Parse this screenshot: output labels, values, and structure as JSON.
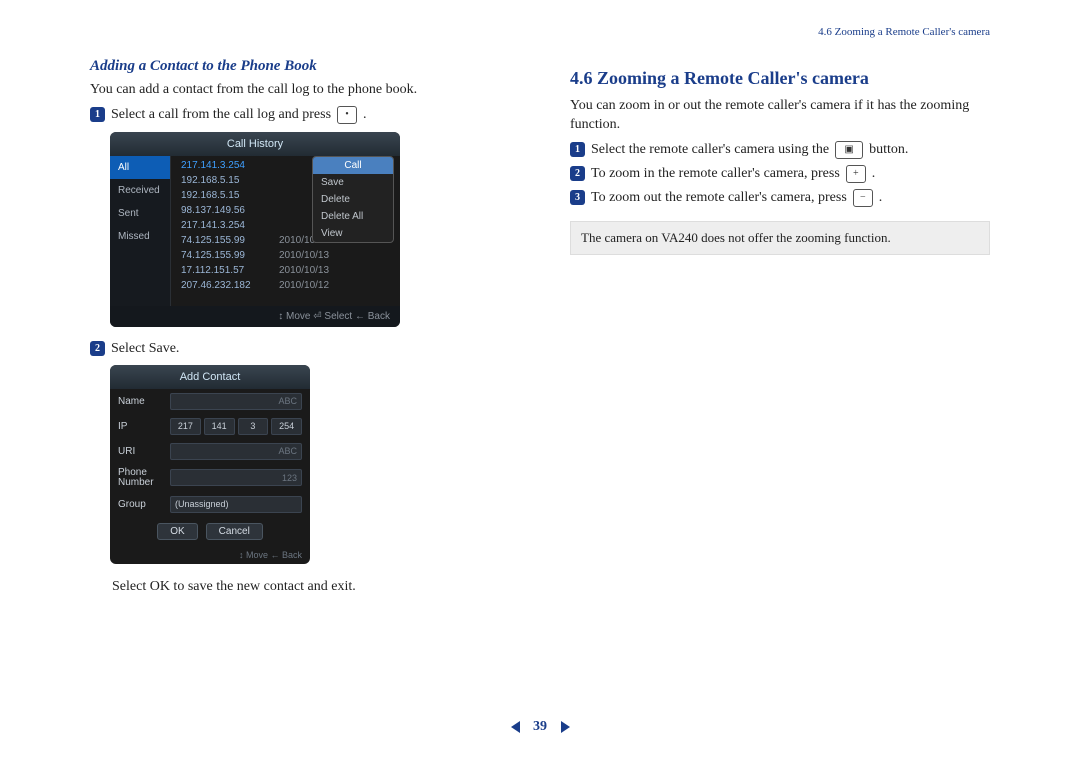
{
  "header": {
    "breadcrumb": "4.6 Zooming a Remote Caller's camera"
  },
  "left": {
    "heading": "Adding a Contact to the Phone Book",
    "intro": "You can add a contact from the call log to the phone book.",
    "step1": "Select a call from the call log and press",
    "step2": "Select Save.",
    "finish": "Select OK to save the new contact and exit.",
    "call_history": {
      "title": "Call History",
      "tabs": [
        "All",
        "Received",
        "Sent",
        "Missed"
      ],
      "rows": [
        {
          "ip": "217.141.3.254",
          "date": ""
        },
        {
          "ip": "192.168.5.15",
          "date": ""
        },
        {
          "ip": "192.168.5.15",
          "date": ""
        },
        {
          "ip": "98.137.149.56",
          "date": ""
        },
        {
          "ip": "217.141.3.254",
          "date": ""
        },
        {
          "ip": "74.125.155.99",
          "date": "2010/10/14"
        },
        {
          "ip": "74.125.155.99",
          "date": "2010/10/13"
        },
        {
          "ip": "17.112.151.57",
          "date": "2010/10/13"
        },
        {
          "ip": "207.46.232.182",
          "date": "2010/10/12"
        }
      ],
      "menu": {
        "header": "Call",
        "items": [
          "Save",
          "Delete",
          "Delete All",
          "View"
        ]
      },
      "footer": "↕ Move   ⏎ Select   ← Back"
    },
    "add_contact": {
      "title": "Add Contact",
      "name_label": "Name",
      "name_hint": "ABC",
      "ip_label": "IP",
      "ip": [
        "217",
        "141",
        "3",
        "254"
      ],
      "uri_label": "URI",
      "uri_hint": "ABC",
      "phone_label": "Phone Number",
      "phone_hint": "123",
      "group_label": "Group",
      "group_value": "(Unassigned)",
      "ok": "OK",
      "cancel": "Cancel",
      "footer": "↕ Move   ← Back"
    }
  },
  "right": {
    "heading": "4.6   Zooming a Remote Caller's camera",
    "intro": "You can zoom in or out the remote caller's camera if it has the zooming function.",
    "step1a": "Select the remote caller's camera using the",
    "step1b": "button.",
    "step2": "To zoom in the remote caller's camera, press",
    "step3": "To zoom out the remote caller's camera, press",
    "note": "The camera on VA240 does not offer the zooming function."
  },
  "pager": {
    "number": "39"
  },
  "icons": {
    "dot": "•",
    "cam": "▣",
    "plus": "+",
    "minus": "−"
  }
}
